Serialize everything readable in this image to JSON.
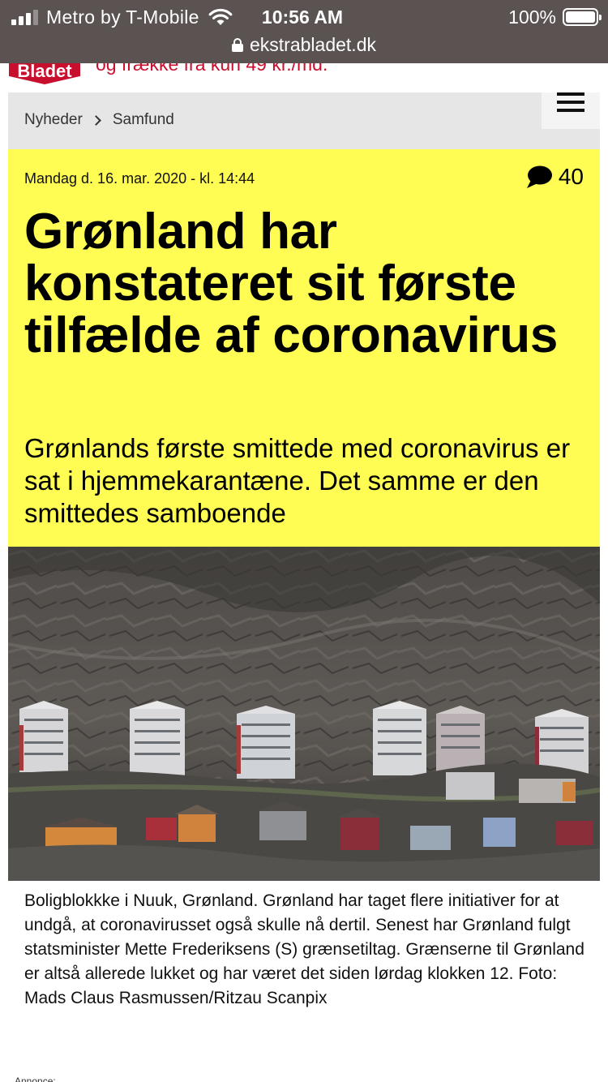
{
  "status_bar": {
    "carrier": "Metro by T-Mobile",
    "time": "10:56 AM",
    "battery": "100%",
    "url": "ekstrabladet.dk"
  },
  "top_banner": {
    "logo": "Bladet",
    "text": "og frække fra kun 49 kr./md."
  },
  "breadcrumb": {
    "items": [
      "Nyheder",
      "Samfund"
    ]
  },
  "article": {
    "date": "Mandag d. 16. mar. 2020 - kl. 14:44",
    "comment_count": "40",
    "headline": "Grønland har konstateret sit første tilfælde af coronavirus",
    "subheadline": "Grønlands første smittede med coronavirus er sat i hjemmekarantæne. Det samme er den smittedes samboende",
    "caption": "Boligblokkke i Nuuk, Grønland. Grønland har taget flere initiativer for at undgå, at coronavirusset også skulle nå dertil. Senest har Grønland fulgt statsminister Mette Frederiksens (S) grænsetiltag. Grænserne til Grønland er altså allerede lukket og har været det siden lørdag klokken 12. Foto: Mads Claus Rasmussen/Ritzau Scanpix"
  },
  "footer": {
    "ad_label": "Annonce:"
  },
  "colors": {
    "header_yellow": "#fffd54",
    "brand_red": "#c8102e",
    "status_bar": "#5b5352"
  }
}
